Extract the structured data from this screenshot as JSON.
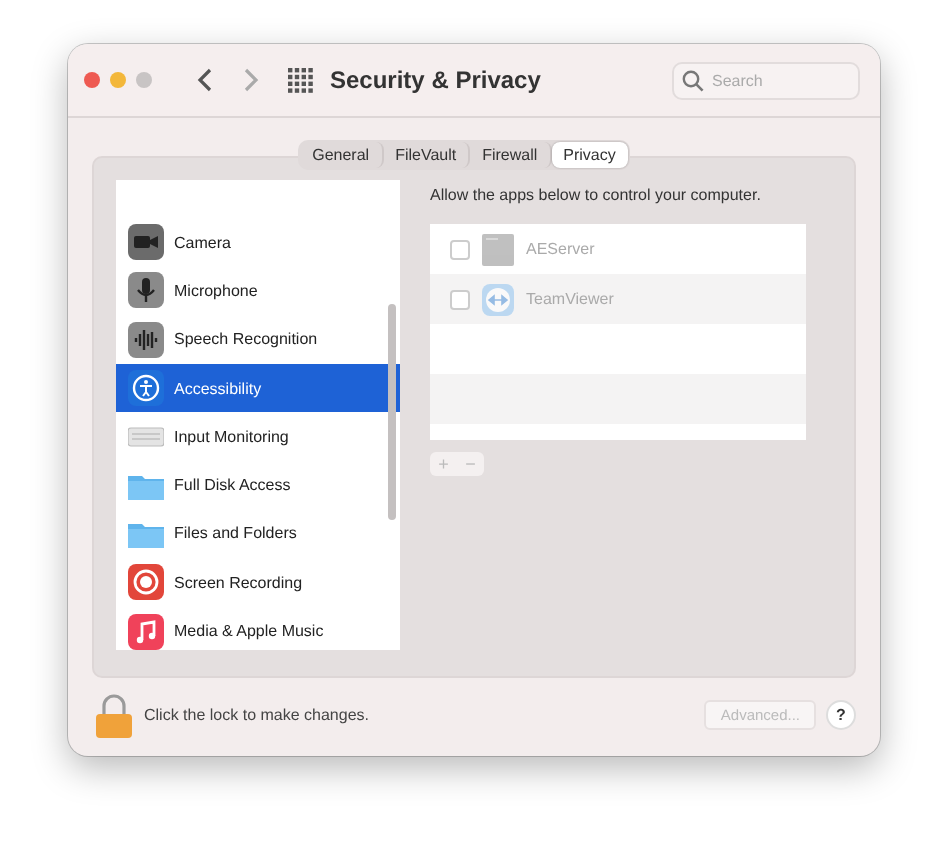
{
  "window": {
    "title": "Security & Privacy"
  },
  "search": {
    "placeholder": "Search"
  },
  "tabs": [
    {
      "label": "General",
      "selected": false
    },
    {
      "label": "FileVault",
      "selected": false
    },
    {
      "label": "Firewall",
      "selected": false
    },
    {
      "label": "Privacy",
      "selected": true
    }
  ],
  "sidebar": {
    "items": [
      {
        "label": "Camera",
        "selected": false
      },
      {
        "label": "Microphone",
        "selected": false
      },
      {
        "label": "Speech Recognition",
        "selected": false
      },
      {
        "label": "Accessibility",
        "selected": true
      },
      {
        "label": "Input Monitoring",
        "selected": false
      },
      {
        "label": "Full Disk Access",
        "selected": false
      },
      {
        "label": "Files and Folders",
        "selected": false
      },
      {
        "label": "Screen Recording",
        "selected": false
      },
      {
        "label": "Media & Apple Music",
        "selected": false
      }
    ]
  },
  "detail": {
    "description": "Allow the apps below to control your computer.",
    "apps": [
      {
        "name": "AEServer",
        "checked": false
      },
      {
        "name": "TeamViewer",
        "checked": false
      }
    ],
    "add_label": "+",
    "remove_label": "−"
  },
  "footer": {
    "locked": true,
    "lock_text": "Click the lock to make changes.",
    "advanced": {
      "label": "Advanced...",
      "disabled": true
    },
    "help": "?"
  }
}
